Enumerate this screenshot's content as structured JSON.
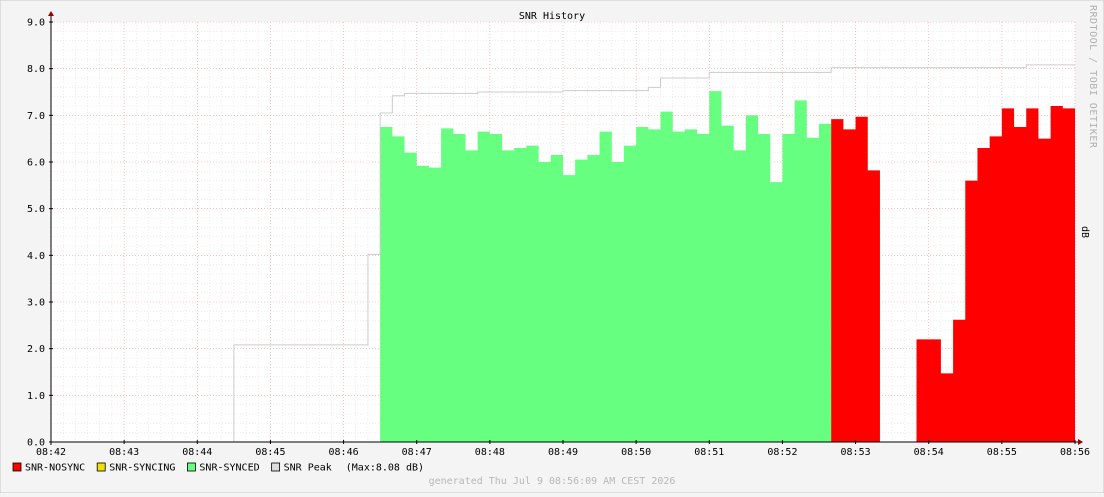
{
  "chart_data": {
    "type": "area",
    "title": "SNR History",
    "ylabel": "dB",
    "watermark": "RRDTOOL / TOBI OETIKER",
    "footer": "generated Thu Jul  9 08:56:09 AM CEST 2026",
    "xlim": [
      "08:42",
      "08:56"
    ],
    "ylim": [
      0,
      9
    ],
    "x_ticks": [
      "08:42",
      "08:43",
      "08:44",
      "08:45",
      "08:46",
      "08:47",
      "08:48",
      "08:49",
      "08:50",
      "08:51",
      "08:52",
      "08:53",
      "08:54",
      "08:55",
      "08:56"
    ],
    "y_ticks": [
      "0.0",
      "1.0",
      "2.0",
      "3.0",
      "4.0",
      "5.0",
      "6.0",
      "7.0",
      "8.0",
      "9.0"
    ],
    "grid": true,
    "legend_position": "bottom-left",
    "legend": [
      {
        "name": "SNR-NOSYNC",
        "color": "#ff0000"
      },
      {
        "name": "SNR-SYNCING",
        "color": "#f0e000"
      },
      {
        "name": "SNR-SYNCED",
        "color": "#66ff80"
      },
      {
        "name": "SNR Peak",
        "color": "#dddddd"
      }
    ],
    "legend_extra": "(Max:8.08 dB)",
    "series": [
      {
        "name": "SNR-SYNCED",
        "color": "#66ff80",
        "start": "08:46:30",
        "step_seconds": 10,
        "values": [
          6.75,
          6.55,
          6.2,
          5.92,
          5.88,
          6.72,
          6.6,
          6.25,
          6.65,
          6.6,
          6.25,
          6.3,
          6.35,
          6.0,
          6.15,
          5.72,
          6.05,
          6.15,
          6.65,
          6.0,
          6.35,
          6.75,
          6.7,
          7.08,
          6.65,
          6.7,
          6.6,
          7.52,
          6.78,
          6.25,
          7.0,
          6.6,
          5.57,
          6.6,
          7.32,
          6.52,
          6.82
        ]
      },
      {
        "name": "SNR-NOSYNC",
        "color": "#ff0000",
        "segments": [
          {
            "start": "08:52:40",
            "step_seconds": 10,
            "values": [
              6.92,
              6.7,
              6.97,
              5.82
            ]
          },
          {
            "start": "08:53:50",
            "step_seconds": 10,
            "values": [
              2.2,
              2.2,
              1.47,
              2.62,
              5.6,
              6.3,
              6.55,
              7.15,
              6.75,
              7.15,
              6.5,
              7.2,
              7.15
            ]
          }
        ]
      },
      {
        "name": "SNR Peak",
        "color": "#cccccc",
        "steps": [
          {
            "t": "08:44:30",
            "v": 2.08
          },
          {
            "t": "08:46:20",
            "v": 4.02
          },
          {
            "t": "08:46:30",
            "v": 7.05
          },
          {
            "t": "08:46:40",
            "v": 7.42
          },
          {
            "t": "08:46:50",
            "v": 7.47
          },
          {
            "t": "08:47:50",
            "v": 7.5
          },
          {
            "t": "08:49:00",
            "v": 7.53
          },
          {
            "t": "08:50:10",
            "v": 7.6
          },
          {
            "t": "08:50:20",
            "v": 7.8
          },
          {
            "t": "08:51:00",
            "v": 7.92
          },
          {
            "t": "08:52:40",
            "v": 8.02
          },
          {
            "t": "08:55:20",
            "v": 8.08
          },
          {
            "t": "08:56:00",
            "v": 8.08
          }
        ]
      }
    ]
  }
}
